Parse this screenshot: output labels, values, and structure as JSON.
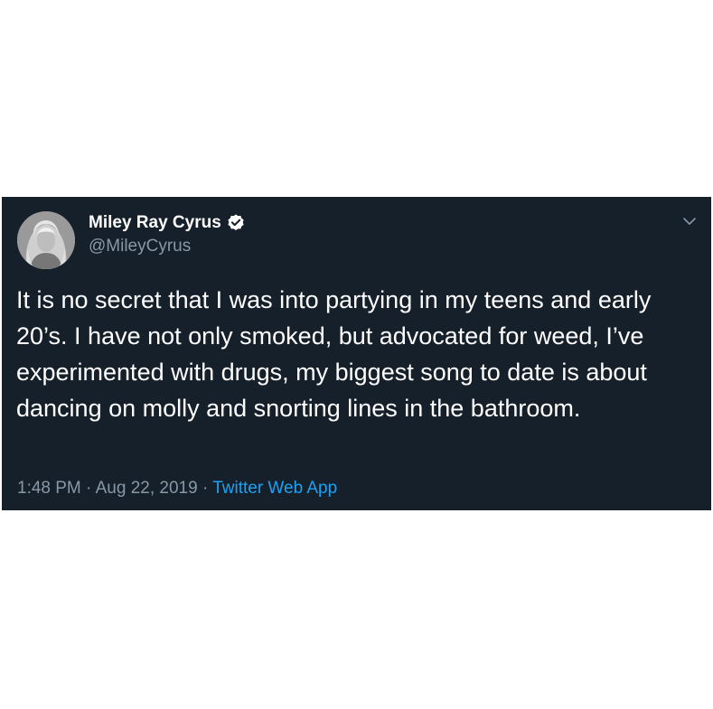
{
  "tweet": {
    "author": {
      "display_name": "Miley Ray Cyrus",
      "handle": "@MileyCyrus",
      "verified": true,
      "avatar_icon": "profile-photo"
    },
    "text": "It is no secret that I was into partying in my teens and early 20’s. I have not only smoked, but advocated for weed, I’ve experimented with drugs, my biggest song to date is about dancing on molly and snorting lines in the bathroom.",
    "meta": {
      "time": "1:48 PM",
      "separator": "·",
      "date": "Aug 22, 2019",
      "source": "Twitter Web App"
    },
    "menu_icon": "chevron-down-icon"
  },
  "colors": {
    "background": "#15202b",
    "text_primary": "#ffffff",
    "text_secondary": "#8899a6",
    "link": "#1da1f2",
    "verified_badge": "#ffffff"
  }
}
